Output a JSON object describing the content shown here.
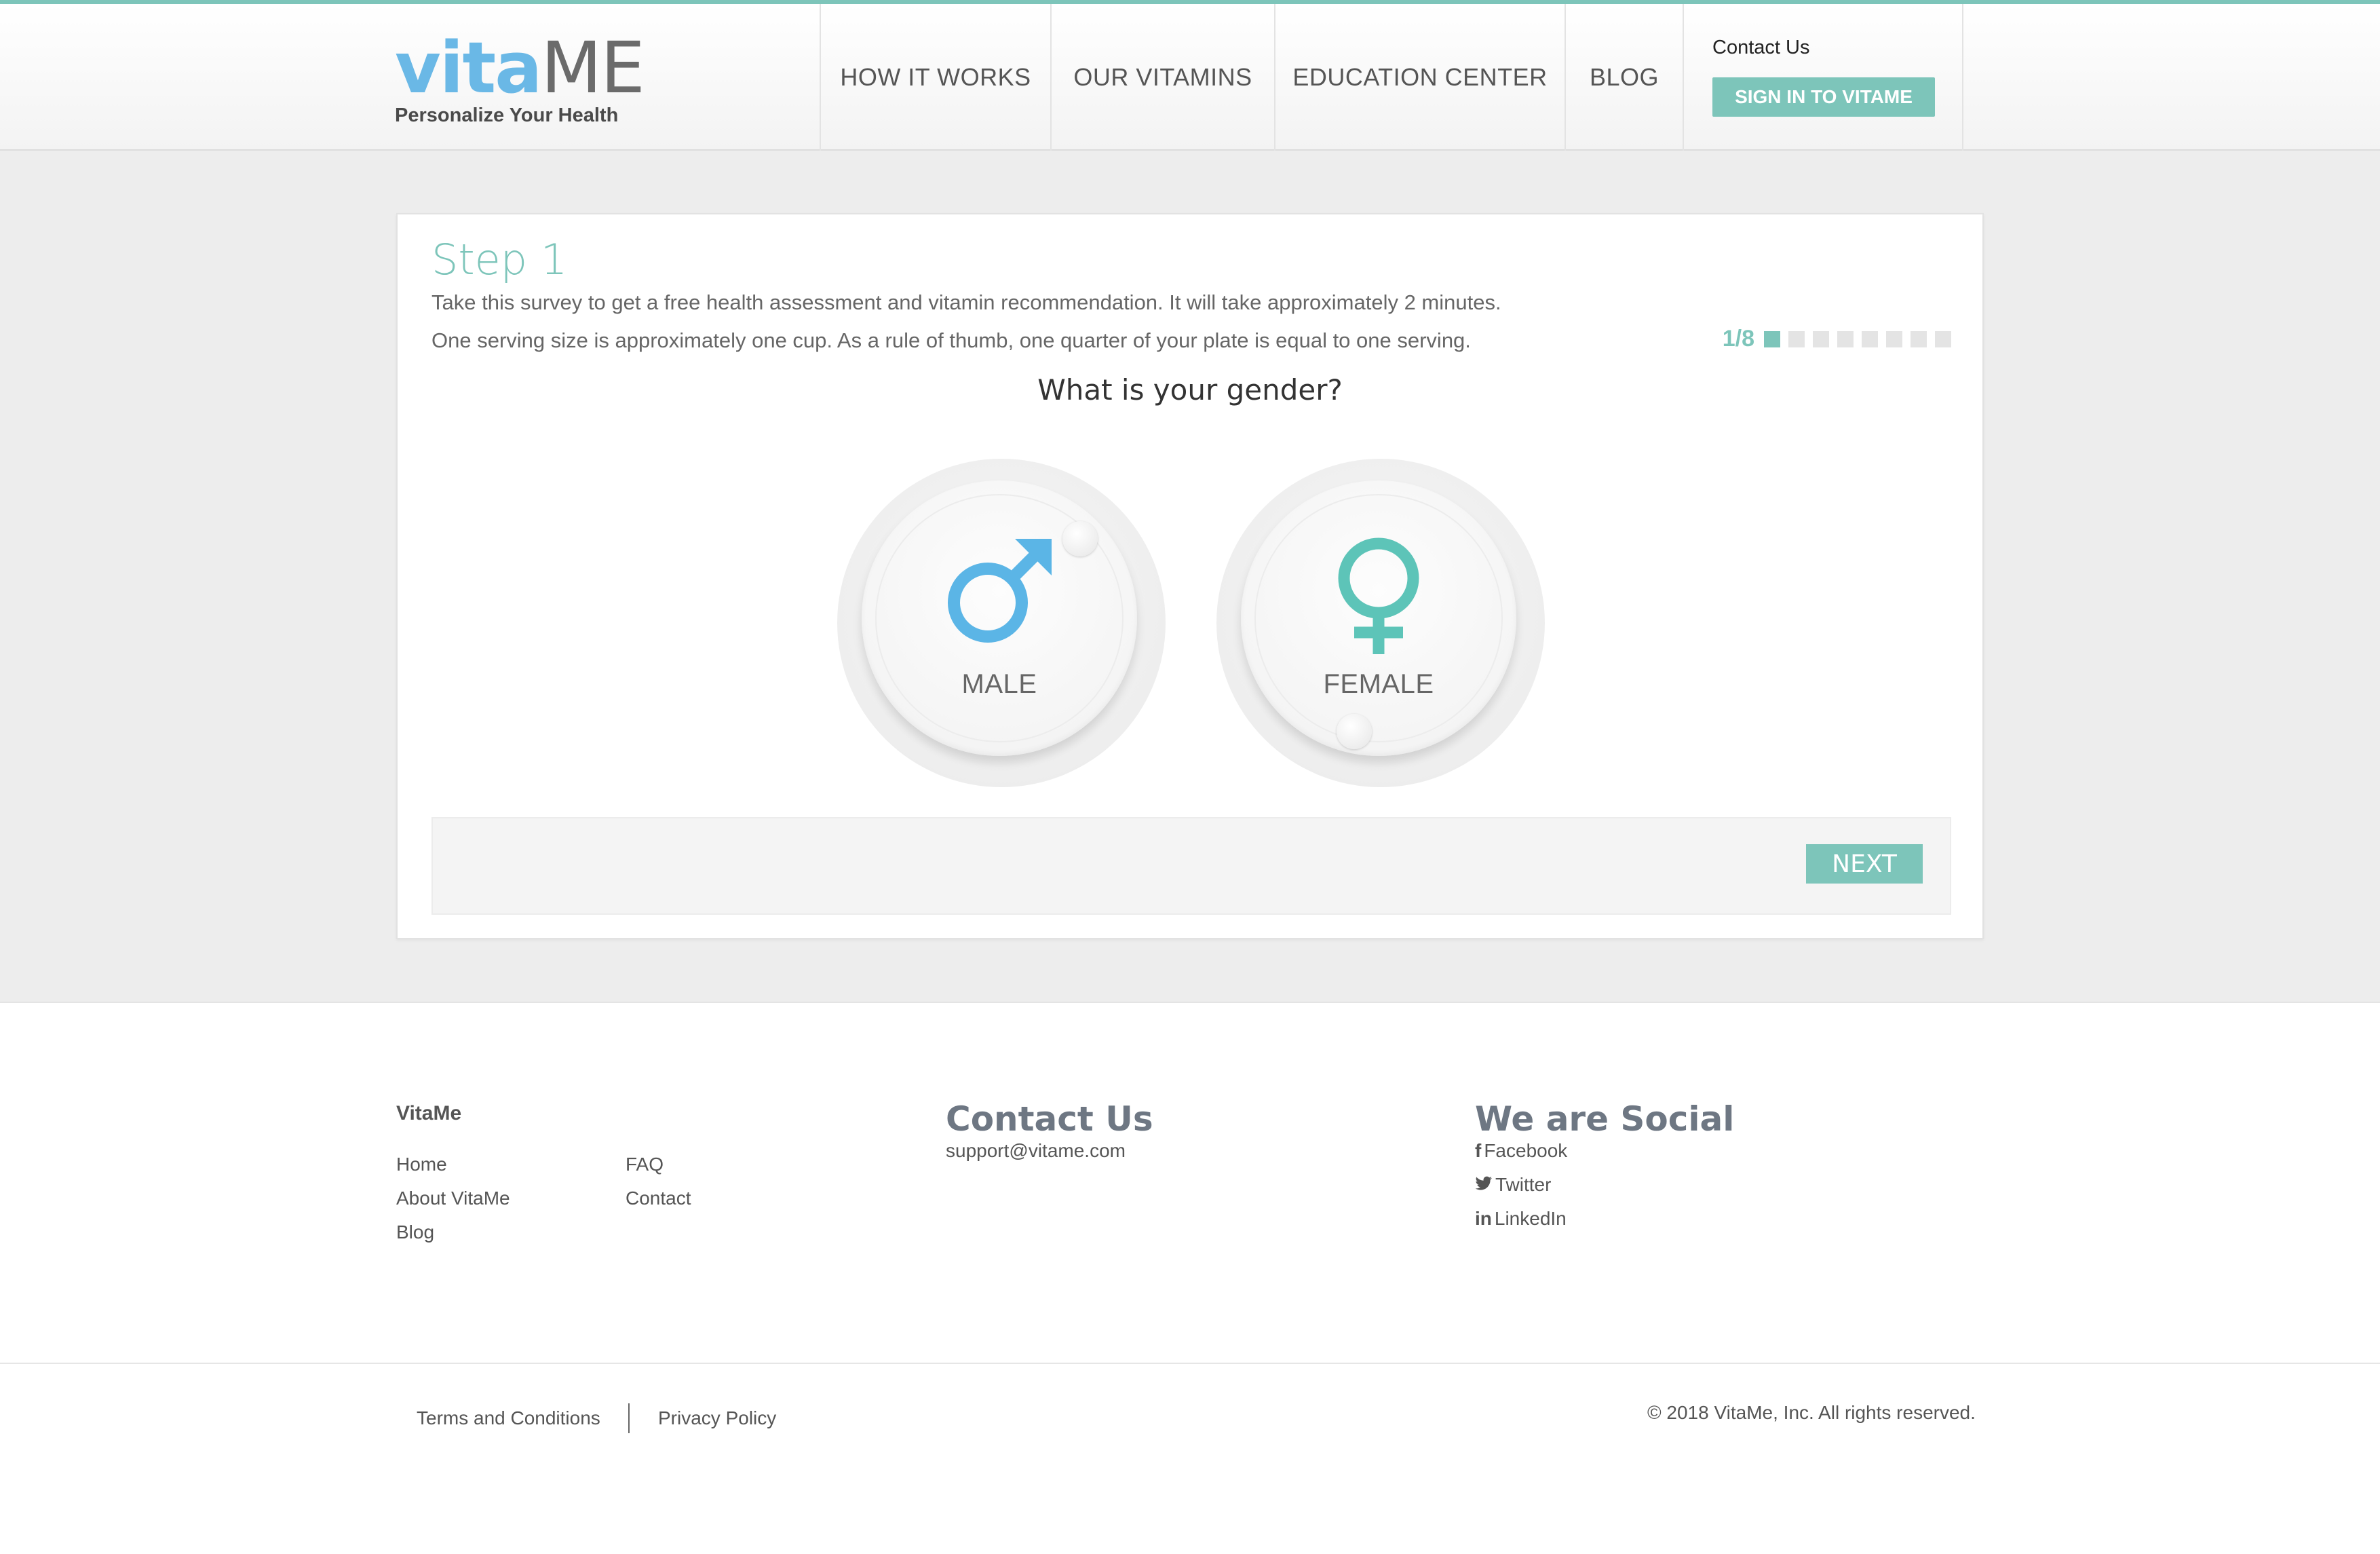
{
  "logo": {
    "vita": "vita",
    "me": "ME",
    "tagline": "Personalize Your Health"
  },
  "nav": {
    "items": [
      {
        "label": "HOW IT WORKS"
      },
      {
        "label": "OUR VITAMINS"
      },
      {
        "label": "EDUCATION CENTER"
      },
      {
        "label": "BLOG"
      }
    ],
    "contact": "Contact Us",
    "signin": "SIGN IN TO VITAME"
  },
  "survey": {
    "step_title": "Step 1",
    "intro_line1": "Take this survey to get a free health assessment and vitamin recommendation. It will take approximately 2 minutes.",
    "intro_line2": "One serving size is approximately one cup. As a rule of thumb, one quarter of your plate is equal to one serving.",
    "progress_text": "1/8",
    "progress_current": 1,
    "progress_total": 8,
    "question": "What is your gender?",
    "options": [
      {
        "label": "MALE",
        "icon": "male-symbol-icon",
        "color": "#5bb5e6"
      },
      {
        "label": "FEMALE",
        "icon": "female-symbol-icon",
        "color": "#5dc4b8"
      }
    ],
    "next": "NEXT"
  },
  "footer": {
    "brand": "VitaMe",
    "links_col1": [
      "Home",
      "About VitaMe",
      "Blog"
    ],
    "links_col2": [
      "FAQ",
      "Contact"
    ],
    "contact_heading": "Contact Us",
    "contact_email": "support@vitame.com",
    "social_heading": "We are Social",
    "social": [
      {
        "icon": "facebook-icon",
        "glyph": "f",
        "label": "Facebook"
      },
      {
        "icon": "twitter-icon",
        "glyph": "❧",
        "label": "Twitter"
      },
      {
        "icon": "linkedin-icon",
        "glyph": "in",
        "label": "LinkedIn"
      }
    ],
    "terms": "Terms and Conditions",
    "privacy": "Privacy Policy",
    "copyright": "© 2018 VitaMe, Inc. All rights reserved."
  },
  "colors": {
    "accent": "#7dc5ba",
    "logo_blue": "#6ab8e6",
    "male": "#5bb5e6",
    "female": "#5dc4b8"
  }
}
